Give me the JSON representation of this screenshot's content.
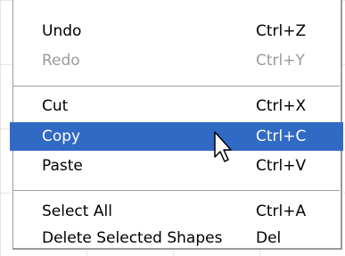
{
  "menu": {
    "items": [
      {
        "label": "Undo",
        "shortcut": "Ctrl+Z",
        "state": "enabled"
      },
      {
        "label": "Redo",
        "shortcut": "Ctrl+Y",
        "state": "disabled"
      },
      {
        "label": "Cut",
        "shortcut": "Ctrl+X",
        "state": "enabled"
      },
      {
        "label": "Copy",
        "shortcut": "Ctrl+C",
        "state": "highlighted"
      },
      {
        "label": "Paste",
        "shortcut": "Ctrl+V",
        "state": "enabled"
      },
      {
        "label": "Select All",
        "shortcut": "Ctrl+A",
        "state": "enabled"
      },
      {
        "label": "Delete Selected Shapes",
        "shortcut": "Del",
        "state": "enabled"
      }
    ]
  },
  "colors": {
    "highlight": "#316ac5",
    "disabled_text": "#9b9b9b"
  },
  "icons": {
    "cursor": "mouse-pointer-icon"
  }
}
